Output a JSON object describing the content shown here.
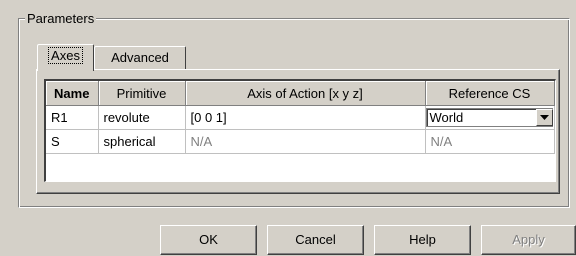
{
  "dialog": {
    "group_title": "Parameters"
  },
  "tabs": [
    {
      "label": "Axes",
      "active": true
    },
    {
      "label": "Advanced",
      "active": false
    }
  ],
  "table": {
    "headers": [
      "Name",
      "Primitive",
      "Axis of Action [x y z]",
      "Reference CS"
    ],
    "rows": [
      {
        "name": "R1",
        "primitive": "revolute",
        "axis": "[0 0 1]",
        "reference": "World",
        "editable": true
      },
      {
        "name": "S",
        "primitive": "spherical",
        "axis": "N/A",
        "reference": "N/A",
        "editable": false
      }
    ]
  },
  "buttons": {
    "ok": "OK",
    "cancel": "Cancel",
    "help": "Help",
    "apply": "Apply"
  },
  "icons": {
    "combo_arrow": "chevron-down-icon"
  }
}
